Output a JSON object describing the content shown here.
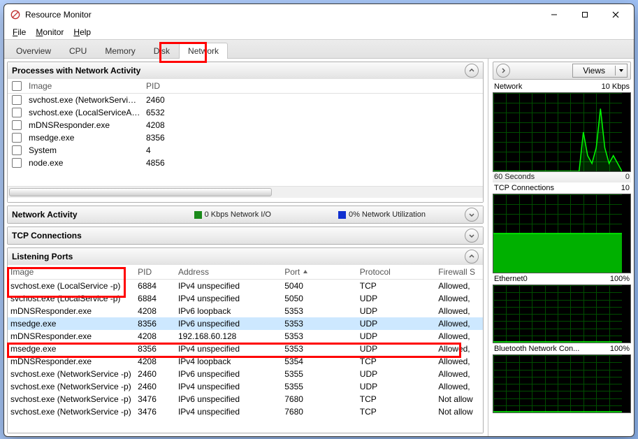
{
  "window": {
    "title": "Resource Monitor"
  },
  "menubar": [
    {
      "accel": "F",
      "rest": "ile"
    },
    {
      "accel": "M",
      "rest": "onitor"
    },
    {
      "accel": "H",
      "rest": "elp"
    }
  ],
  "tabs": [
    "Overview",
    "CPU",
    "Memory",
    "Disk",
    "Network"
  ],
  "active_tab": "Network",
  "panels": {
    "processes": {
      "title": "Processes with Network Activity",
      "columns": [
        "Image",
        "PID"
      ],
      "rows": [
        {
          "image": "svchost.exe (NetworkService...",
          "pid": "2460"
        },
        {
          "image": "svchost.exe (LocalServiceAn...",
          "pid": "6532"
        },
        {
          "image": "mDNSResponder.exe",
          "pid": "4208"
        },
        {
          "image": "msedge.exe",
          "pid": "8356"
        },
        {
          "image": "System",
          "pid": "4"
        },
        {
          "image": "node.exe",
          "pid": "4856"
        }
      ]
    },
    "netActivity": {
      "title": "Network Activity",
      "io": "0 Kbps Network I/O",
      "util": "0% Network Utilization"
    },
    "tcp": {
      "title": "TCP Connections"
    },
    "ports": {
      "title": "Listening Ports",
      "columns": [
        "Image",
        "PID",
        "Address",
        "Port",
        "Protocol",
        "Firewall S"
      ],
      "sort_column": "Port",
      "sort_dir": "asc",
      "rows": [
        {
          "image": "svchost.exe (LocalService -p)",
          "pid": "6884",
          "addr": "IPv4 unspecified",
          "port": "5040",
          "proto": "TCP",
          "fw": "Allowed,"
        },
        {
          "image": "svchost.exe (LocalService -p)",
          "pid": "6884",
          "addr": "IPv4 unspecified",
          "port": "5050",
          "proto": "UDP",
          "fw": "Allowed,"
        },
        {
          "image": "mDNSResponder.exe",
          "pid": "4208",
          "addr": "IPv6 loopback",
          "port": "5353",
          "proto": "UDP",
          "fw": "Allowed,"
        },
        {
          "image": "msedge.exe",
          "pid": "8356",
          "addr": "IPv6 unspecified",
          "port": "5353",
          "proto": "UDP",
          "fw": "Allowed,",
          "selected": true
        },
        {
          "image": "mDNSResponder.exe",
          "pid": "4208",
          "addr": "192.168.60.128",
          "port": "5353",
          "proto": "UDP",
          "fw": "Allowed,"
        },
        {
          "image": "msedge.exe",
          "pid": "8356",
          "addr": "IPv4 unspecified",
          "port": "5353",
          "proto": "UDP",
          "fw": "Allowed,"
        },
        {
          "image": "mDNSResponder.exe",
          "pid": "4208",
          "addr": "IPv4 loopback",
          "port": "5354",
          "proto": "TCP",
          "fw": "Allowed,"
        },
        {
          "image": "svchost.exe (NetworkService -p)",
          "pid": "2460",
          "addr": "IPv6 unspecified",
          "port": "5355",
          "proto": "UDP",
          "fw": "Allowed,"
        },
        {
          "image": "svchost.exe (NetworkService -p)",
          "pid": "2460",
          "addr": "IPv4 unspecified",
          "port": "5355",
          "proto": "UDP",
          "fw": "Allowed,"
        },
        {
          "image": "svchost.exe (NetworkService -p)",
          "pid": "3476",
          "addr": "IPv6 unspecified",
          "port": "7680",
          "proto": "TCP",
          "fw": "Not allow"
        },
        {
          "image": "svchost.exe (NetworkService -p)",
          "pid": "3476",
          "addr": "IPv4 unspecified",
          "port": "7680",
          "proto": "TCP",
          "fw": "Not allow"
        }
      ]
    }
  },
  "side": {
    "viewsLabel": "Views",
    "charts": [
      {
        "title": "Network",
        "scale": "10 Kbps",
        "captionL": "60 Seconds",
        "captionR": "0",
        "style": "spike"
      },
      {
        "title": "TCP Connections",
        "scale": "10",
        "style": "block"
      },
      {
        "title": "Ethernet0",
        "scale": "100%",
        "style": "flat",
        "short": true
      },
      {
        "title": "Bluetooth Network Con...",
        "scale": "100%",
        "style": "flat",
        "short": true
      }
    ]
  },
  "chart_data": [
    {
      "type": "line",
      "title": "Network",
      "xlabel": "60 Seconds",
      "ylabel": "",
      "ylim": [
        0,
        10
      ],
      "unit": "Kbps",
      "x": [
        0,
        5,
        10,
        15,
        20,
        25,
        30,
        35,
        40,
        42,
        44,
        46,
        48,
        50,
        52,
        54,
        56,
        58,
        60
      ],
      "values": [
        0,
        0,
        0,
        0,
        0,
        0,
        0,
        0,
        0,
        5,
        2,
        1,
        3,
        8,
        3,
        1,
        2,
        1,
        0
      ]
    },
    {
      "type": "area",
      "title": "TCP Connections",
      "ylim": [
        0,
        10
      ],
      "x": [
        0,
        60
      ],
      "values": [
        5,
        5
      ]
    },
    {
      "type": "line",
      "title": "Ethernet0",
      "ylim": [
        0,
        100
      ],
      "unit": "%",
      "x": [
        0,
        60
      ],
      "values": [
        0,
        0
      ]
    },
    {
      "type": "line",
      "title": "Bluetooth Network Connection",
      "ylim": [
        0,
        100
      ],
      "unit": "%",
      "x": [
        0,
        60
      ],
      "values": [
        0,
        0
      ]
    }
  ]
}
